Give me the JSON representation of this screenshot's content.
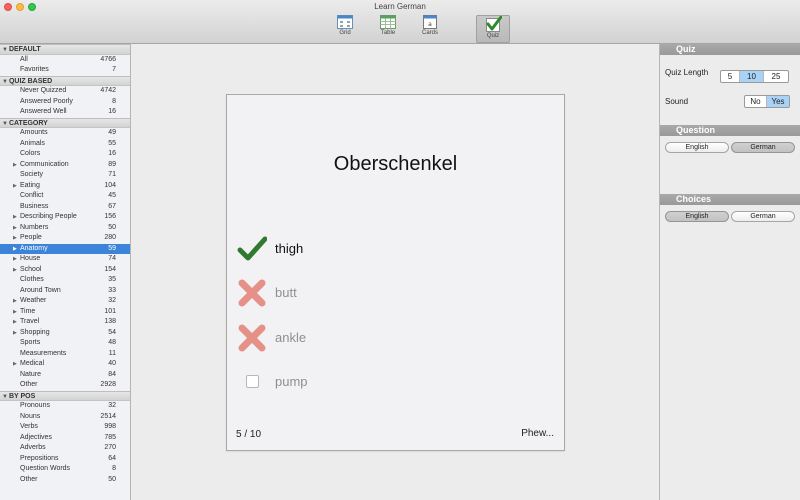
{
  "window": {
    "title": "Learn German"
  },
  "toolbar": {
    "tools": [
      {
        "label": "Grid"
      },
      {
        "label": "Table"
      },
      {
        "label": "Cards"
      },
      {
        "label": "Quiz"
      }
    ]
  },
  "sidebar": {
    "sections": [
      {
        "title": "DEFAULT",
        "items": [
          {
            "label": "All",
            "count": "4766"
          },
          {
            "label": "Favorites",
            "count": "7"
          }
        ]
      },
      {
        "title": "QUIZ BASED",
        "items": [
          {
            "label": "Never Quizzed",
            "count": "4742"
          },
          {
            "label": "Answered Poorly",
            "count": "8"
          },
          {
            "label": "Answered Well",
            "count": "16"
          }
        ]
      },
      {
        "title": "CATEGORY",
        "items": [
          {
            "label": "Amounts",
            "count": "49"
          },
          {
            "label": "Animals",
            "count": "55"
          },
          {
            "label": "Colors",
            "count": "16"
          },
          {
            "label": "Communication",
            "count": "89"
          },
          {
            "label": "Society",
            "count": "71"
          },
          {
            "label": "Eating",
            "count": "104"
          },
          {
            "label": "Conflict",
            "count": "45"
          },
          {
            "label": "Business",
            "count": "67"
          },
          {
            "label": "Describing People",
            "count": "156"
          },
          {
            "label": "Numbers",
            "count": "50"
          },
          {
            "label": "People",
            "count": "280"
          },
          {
            "label": "Anatomy",
            "count": "59"
          },
          {
            "label": "House",
            "count": "74"
          },
          {
            "label": "School",
            "count": "154"
          },
          {
            "label": "Clothes",
            "count": "35"
          },
          {
            "label": "Around Town",
            "count": "33"
          },
          {
            "label": "Weather",
            "count": "32"
          },
          {
            "label": "Time",
            "count": "101"
          },
          {
            "label": "Travel",
            "count": "138"
          },
          {
            "label": "Shopping",
            "count": "54"
          },
          {
            "label": "Sports",
            "count": "48"
          },
          {
            "label": "Measurements",
            "count": "11"
          },
          {
            "label": "Medical",
            "count": "40"
          },
          {
            "label": "Nature",
            "count": "84"
          },
          {
            "label": "Other",
            "count": "2928"
          }
        ]
      },
      {
        "title": "BY POS",
        "items": [
          {
            "label": "Pronouns",
            "count": "32"
          },
          {
            "label": "Nouns",
            "count": "2514"
          },
          {
            "label": "Verbs",
            "count": "998"
          },
          {
            "label": "Adjectives",
            "count": "785"
          },
          {
            "label": "Adverbs",
            "count": "270"
          },
          {
            "label": "Prepositions",
            "count": "64"
          },
          {
            "label": "Question Words",
            "count": "8"
          },
          {
            "label": "Other",
            "count": "50"
          }
        ]
      }
    ]
  },
  "card": {
    "word": "Oberschenkel",
    "choices": [
      {
        "text": "thigh"
      },
      {
        "text": "butt"
      },
      {
        "text": "ankle"
      },
      {
        "text": "pump"
      }
    ],
    "progress": "5 / 10",
    "feedback": "Phew..."
  },
  "rpanel": {
    "quiz": {
      "title": "Quiz",
      "length_label": "Quiz Length",
      "lengths": [
        "5",
        "10",
        "25"
      ],
      "sound_label": "Sound",
      "sound_options": [
        "No",
        "Yes"
      ]
    },
    "question": {
      "title": "Question",
      "options": [
        "English",
        "German"
      ]
    },
    "choices": {
      "title": "Choices",
      "options": [
        "English",
        "German"
      ]
    }
  },
  "colors": {
    "selection": "#3b84d9",
    "correct": "#2f7a2f",
    "wrong": "#e08a80",
    "segment_on": "#a9d2f7"
  }
}
